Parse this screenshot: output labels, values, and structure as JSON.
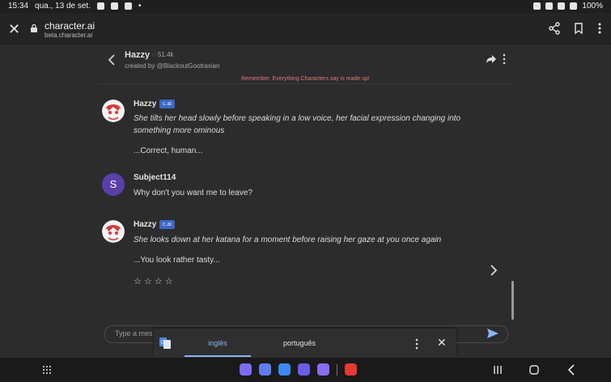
{
  "status_bar": {
    "time": "15:34",
    "date": "qua., 13 de set.",
    "battery": "100%"
  },
  "browser": {
    "title": "character.ai",
    "url": "beta.character.ai"
  },
  "chat_header": {
    "name": "Hazzy",
    "count": "51.4k",
    "creator": "created by @BlackoutGootraxian",
    "notice": "Remember: Everything Characters say is made up!"
  },
  "messages": [
    {
      "author": "Hazzy",
      "badge": "c.ai",
      "line1": "She tilts her head slowly before speaking in a low voice, her facial expression changing into",
      "line2": "something more ominous",
      "line3": "...Correct, human..."
    },
    {
      "author": "Subject114",
      "avatar_letter": "S",
      "text": "Why don't you want me to leave?"
    },
    {
      "author": "Hazzy",
      "badge": "c.ai",
      "line1": "She looks down at her katana for a moment before raising her gaze at you once again",
      "line2": "...You look rather tasty..."
    }
  ],
  "rating": {
    "stars": "☆ ☆ ☆ ☆"
  },
  "input": {
    "placeholder": "Type a mes"
  },
  "translate": {
    "tab_source": "inglês",
    "tab_target": "português"
  },
  "colors": {
    "accent": "#8ab4f8",
    "notice": "#e07878",
    "badge": "#3b66c6"
  }
}
